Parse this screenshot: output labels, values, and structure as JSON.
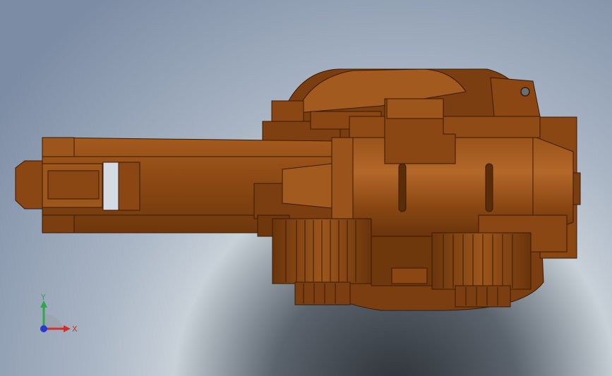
{
  "viewport": {
    "background_top": "#7d8ea6",
    "background_light": "#d4dbe3",
    "background_shadow": "#2c3036"
  },
  "model": {
    "base_color": "#8a4713",
    "highlight_color": "#b86a2c",
    "dark_color": "#5a2c08",
    "edge_color": "#3a1a04"
  },
  "triad": {
    "x_label": "X",
    "y_label": "Y",
    "x_color": "#d0302a",
    "y_color": "#2ea84a",
    "z_color": "#2a3ad0"
  }
}
